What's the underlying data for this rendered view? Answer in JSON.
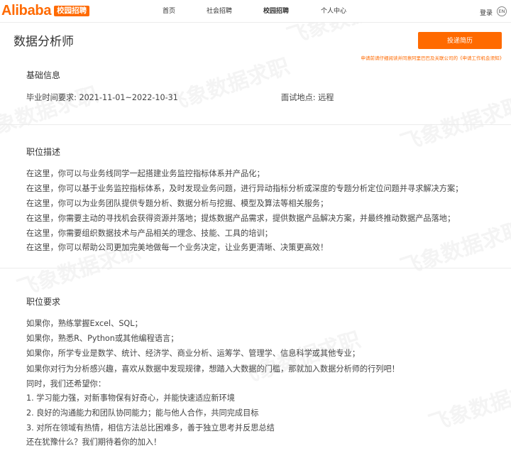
{
  "brand": {
    "logo_text": "Alibaba",
    "badge_text": "校园招聘",
    "color": "#ff6a00"
  },
  "nav": {
    "home": "首页",
    "social": "社会招聘",
    "campus": "校园招聘",
    "center": "个人中心"
  },
  "header": {
    "login": "登录",
    "lang_icon": "EN"
  },
  "job": {
    "title": "数据分析师",
    "apply_button": "投递简历",
    "notice_prefix": "申请前请仔细阅读并同意阿里巴巴及关联公司的",
    "notice_link": "《申请工作机会须知》"
  },
  "basic": {
    "heading": "基础信息",
    "graduation": "毕业时间要求: 2021-11-01~2022-10-31",
    "interview": "面试地点: 远程"
  },
  "description": {
    "heading": "职位描述",
    "lines": [
      "在这里，你可以与业务线同学一起搭建业务监控指标体系并产品化；",
      "在这里，你可以基于业务监控指标体系，及时发现业务问题，进行异动指标分析或深度的专题分析定位问题并寻求解决方案；",
      "在这里，你可以为业务团队提供专题分析、数据分析与挖掘、模型及算法等相关服务；",
      "在这里，你需要主动的寻找机会获得资源并落地；提炼数据产品需求，提供数据产品解决方案，并最终推动数据产品落地；",
      "在这里，你需要组织数据技术与产品相关的理念、技能、工具的培训；",
      "在这里，你可以帮助公司更加完美地做每一个业务决定，让业务更清晰、决策更高效！"
    ]
  },
  "requirements": {
    "heading": "职位要求",
    "lines": [
      "如果你，熟练掌握Excel、SQL；",
      "如果你，熟悉R、Python或其他编程语言；",
      "如果你，所学专业是数学、统计、经济学、商业分析、运筹学、管理学、信息科学或其他专业；",
      "如果你对行为分析感兴趣，喜欢从数据中发现规律，想踏入大数据的门槛，那就加入数据分析师的行列吧！",
      "同时，我们还希望你：",
      "1. 学习能力强，对新事物保有好奇心，并能快速适应新环境",
      "2. 良好的沟通能力和团队协同能力；能与他人合作，共同完成目标",
      "3. 对所在领域有热情，相信方法总比困难多，善于独立思考并反思总结",
      "还在犹豫什么？我们期待着你的加入！"
    ]
  },
  "watermark": "飞象数据求职"
}
